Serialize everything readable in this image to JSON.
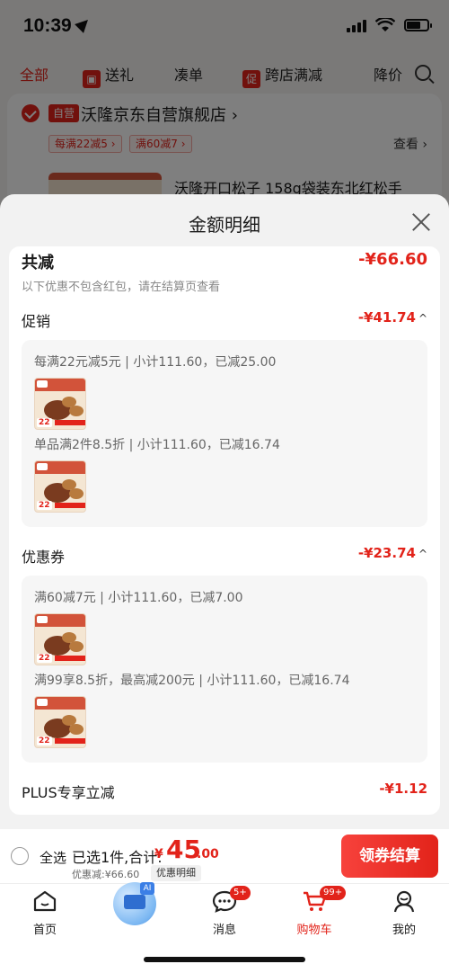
{
  "status_bar": {
    "time": "10:39"
  },
  "filters": {
    "all": "全部",
    "gift": "送礼",
    "bundle": "凑单",
    "cross_shop_badge": "促",
    "cross_shop": "跨店满减",
    "price_drop": "降价"
  },
  "shop": {
    "self_tag": "自营",
    "name": "沃隆京东自营旗舰店 ›",
    "coupons": [
      "每满22减5 ›",
      "满60减7 ›"
    ],
    "look": "查看 ›",
    "product_title": "沃隆开口松子 158g袋装东北红松手"
  },
  "sheet": {
    "title": "金额明细",
    "total": {
      "label": "共减",
      "value": "-¥66.60",
      "note": "以下优惠不包含红包，请在结算页查看"
    },
    "promotion": {
      "label": "促销",
      "value": "-¥41.74",
      "rules": [
        {
          "text": "每满22元减5元 | 小计111.60，已减25.00",
          "tag": "22"
        },
        {
          "text": "单品满2件8.5折 | 小计111.60，已减16.74",
          "tag": "22"
        }
      ]
    },
    "coupon": {
      "label": "优惠券",
      "value": "-¥23.74",
      "rules": [
        {
          "text": "满60减7元 | 小计111.60，已减7.00",
          "tag": "22"
        },
        {
          "text": "满99享8.5折，最高减200元 | 小计111.60，已减16.74",
          "tag": "22"
        }
      ]
    },
    "plus": {
      "label": "PLUS专享立减",
      "value": "-¥1.12"
    },
    "caret": "^"
  },
  "checkout": {
    "select_all": "全选",
    "summary": "已选1件,合计:",
    "currency": "¥",
    "price_int": "45",
    "price_dec": ".00",
    "discount": "优惠减:¥66.60",
    "detail_chip": "优惠明细",
    "button": "领券结算"
  },
  "tabbar": {
    "home": "首页",
    "ai_badge": "AI",
    "messages": "消息",
    "messages_badge": "5+",
    "cart": "购物车",
    "cart_badge": "99+",
    "me": "我的"
  },
  "colors": {
    "accent": "#e2231a",
    "sheet_bg": "#f2f2f2"
  }
}
